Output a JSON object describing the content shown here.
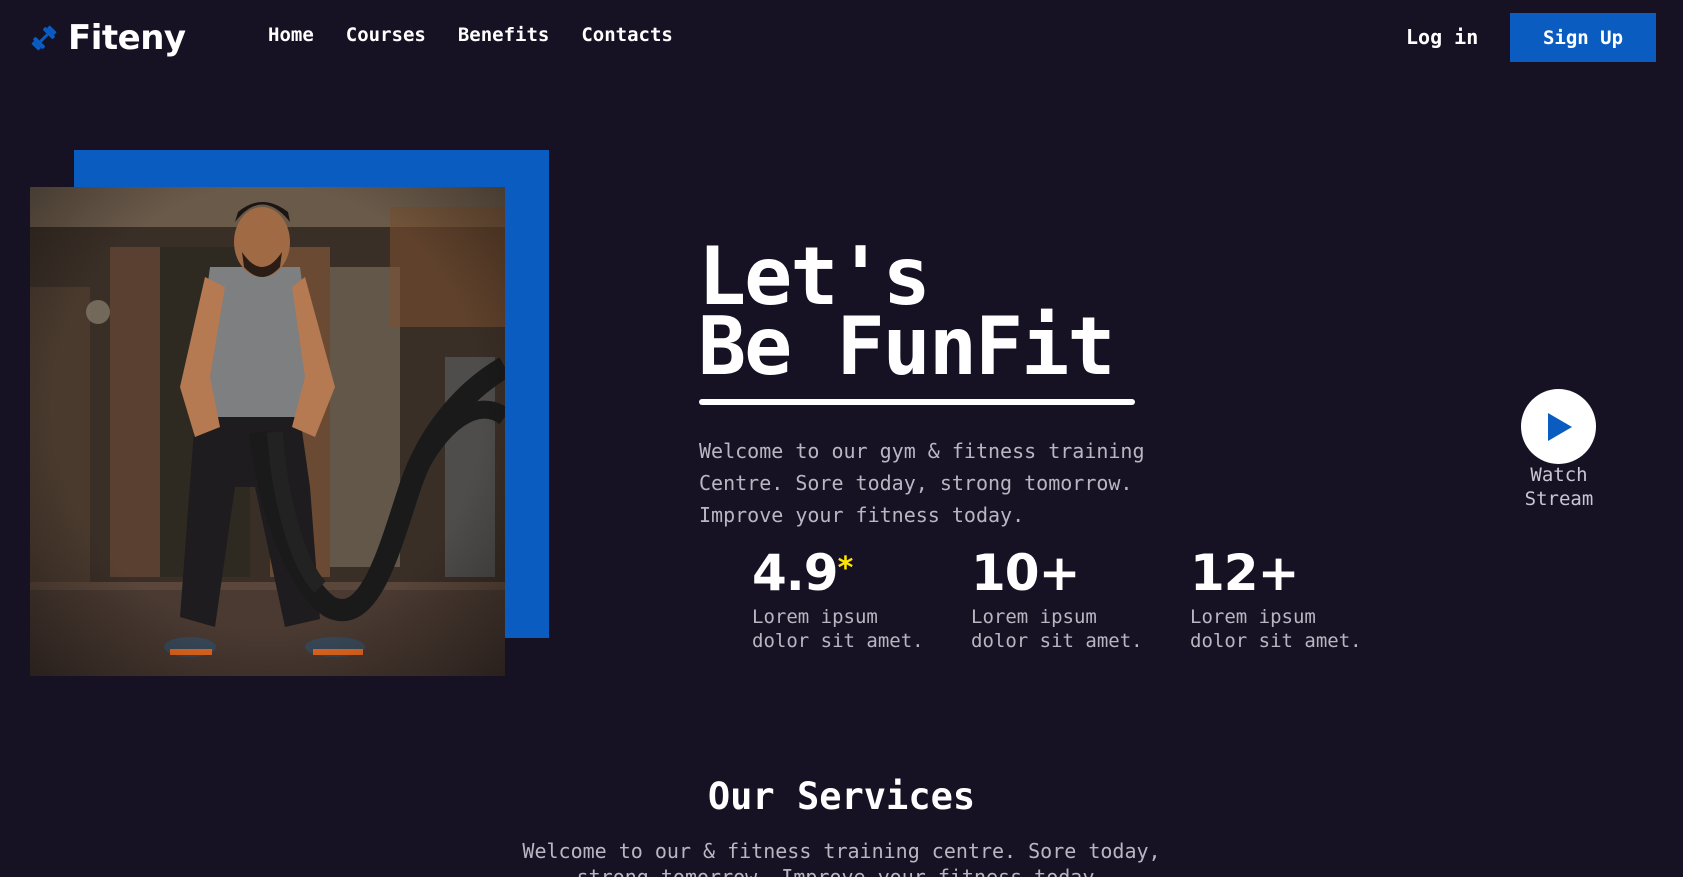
{
  "brand": {
    "name": "Fiteny",
    "icon": "dumbbell-icon",
    "accent_color": "#0a5cc1"
  },
  "nav": {
    "items": [
      {
        "label": "Home"
      },
      {
        "label": "Courses"
      },
      {
        "label": "Benefits"
      },
      {
        "label": "Contacts"
      }
    ]
  },
  "auth": {
    "login_label": "Log in",
    "signup_label": "Sign Up"
  },
  "hero": {
    "title_line1": "Let's",
    "title_line2": "Be FunFit",
    "description": "Welcome to our gym & fitness training Centre. Sore today, strong tomorrow. Improve your fitness today.",
    "image": "man-training-with-battle-ropes",
    "stats": [
      {
        "value": "4.9",
        "suffix": "*",
        "label": "Lorem ipsum\ndolor sit amet."
      },
      {
        "value": "10+",
        "suffix": "",
        "label": "Lorem ipsum\ndolor sit amet."
      },
      {
        "value": "12+",
        "suffix": "",
        "label": "Lorem ipsum\ndolor sit amet."
      }
    ]
  },
  "watch": {
    "label": "Watch\nStream",
    "icon": "play-icon"
  },
  "services": {
    "title": "Our Services",
    "description": "Welcome to our & fitness training centre. Sore today, strong tomorrow. Improve your fitness today."
  }
}
